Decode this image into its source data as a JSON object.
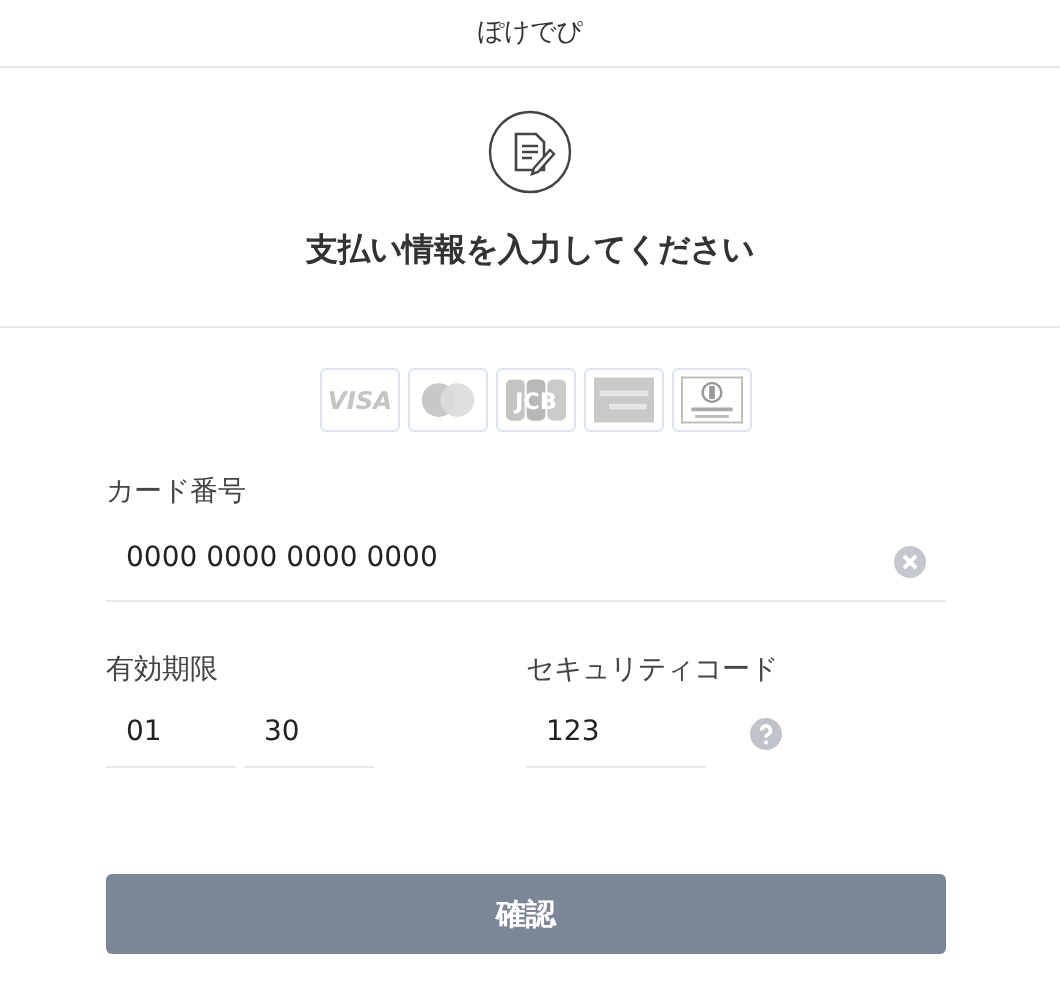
{
  "header": {
    "title": "ぽけでぴ"
  },
  "heading": "支払い情報を入力してください",
  "cards": [
    {
      "kind": "visa",
      "label": "VISA"
    },
    {
      "kind": "master"
    },
    {
      "kind": "jcb",
      "label": "JCB"
    },
    {
      "kind": "amex"
    },
    {
      "kind": "diners"
    }
  ],
  "card_number": {
    "label": "カード番号",
    "value": "0000 0000 0000 0000"
  },
  "expiry": {
    "label": "有効期限",
    "month": "01",
    "year": "30"
  },
  "security_code": {
    "label": "セキュリティコード",
    "value": "123"
  },
  "submit": {
    "label": "確認"
  }
}
